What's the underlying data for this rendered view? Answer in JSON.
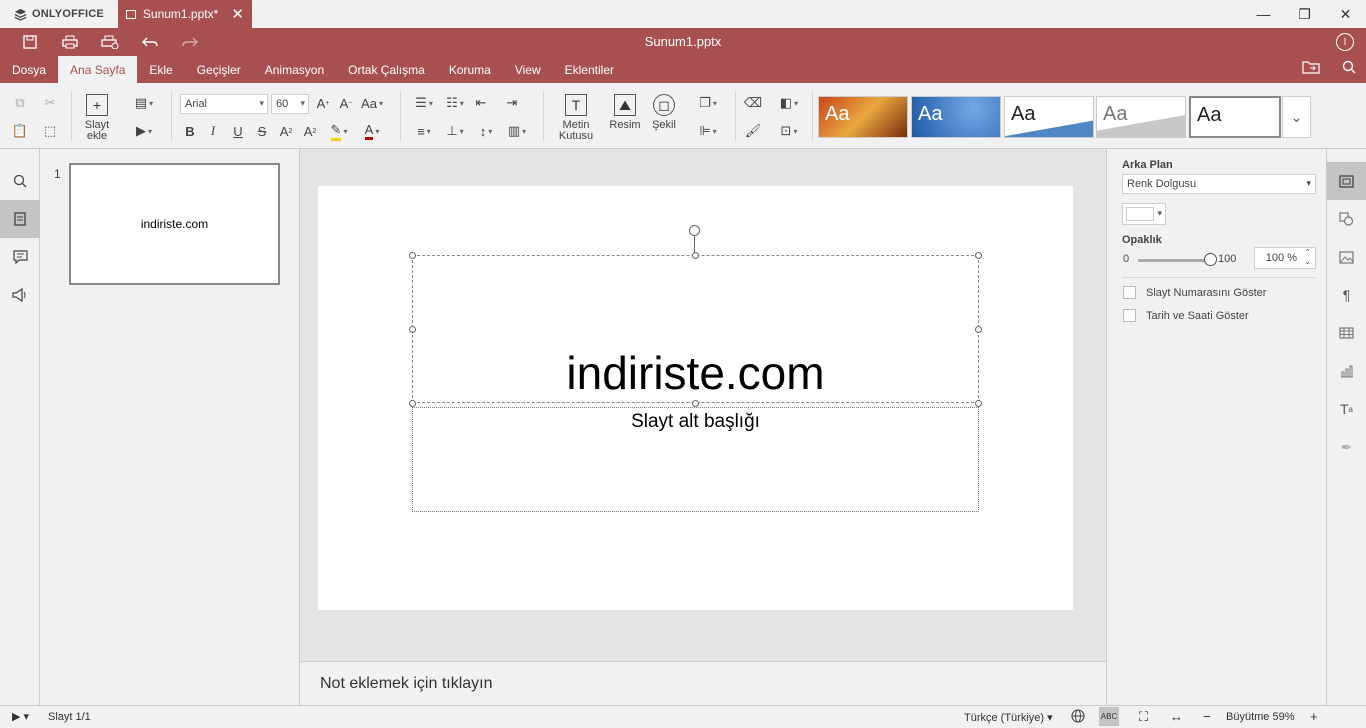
{
  "titlebar": {
    "app_name": "ONLYOFFICE",
    "tab_title": "Sunum1.pptx*",
    "close_glyph": "✕",
    "minimize_glyph": "—",
    "restore_glyph": "❐",
    "window_close_glyph": "✕"
  },
  "header": {
    "doc_title": "Sunum1.pptx",
    "user_initial": "I",
    "accent_color": "#a85050",
    "quick_access": [
      {
        "name": "save-icon",
        "glyph": "💾"
      },
      {
        "name": "print-icon",
        "glyph": "⎙"
      },
      {
        "name": "quick-print-icon",
        "glyph": "⎙"
      },
      {
        "name": "undo-icon",
        "glyph": "↶"
      },
      {
        "name": "redo-icon",
        "glyph": "↷"
      }
    ],
    "menu": [
      "Dosya",
      "Ana Sayfa",
      "Ekle",
      "Geçişler",
      "Animasyon",
      "Ortak Çalışma",
      "Koruma",
      "View",
      "Eklentiler"
    ],
    "active_menu": "Ana Sayfa"
  },
  "ribbon": {
    "add_slide_line1": "Slayt",
    "add_slide_line2": "ekle",
    "font_name": "Arial",
    "font_size": "60",
    "textbox_line1": "Metin",
    "textbox_line2": "Kutusu",
    "image_label": "Resim",
    "shape_label": "Şekil",
    "theme_sample": "Aa"
  },
  "thumbnails": {
    "slide_number": "1",
    "slide_text": "indiriste.com"
  },
  "slide": {
    "title": "indiriste.com",
    "subtitle": "Slayt alt başlığı"
  },
  "notes": {
    "placeholder": "Not eklemek için tıklayın"
  },
  "right_panel": {
    "background_label": "Arka Plan",
    "fill_type": "Renk Dolgusu",
    "opacity_label": "Opaklık",
    "opacity_min": "0",
    "opacity_max": "100",
    "opacity_value": "100 %",
    "opacity_fraction": 1.0,
    "show_slide_number": "Slayt Numarasını Göster",
    "show_date_time": "Tarih ve Saati Göster"
  },
  "statusbar": {
    "slide_count": "Slayt 1/1",
    "language": "Türkçe (Türkiye)",
    "zoom": "Büyütme 59%"
  }
}
